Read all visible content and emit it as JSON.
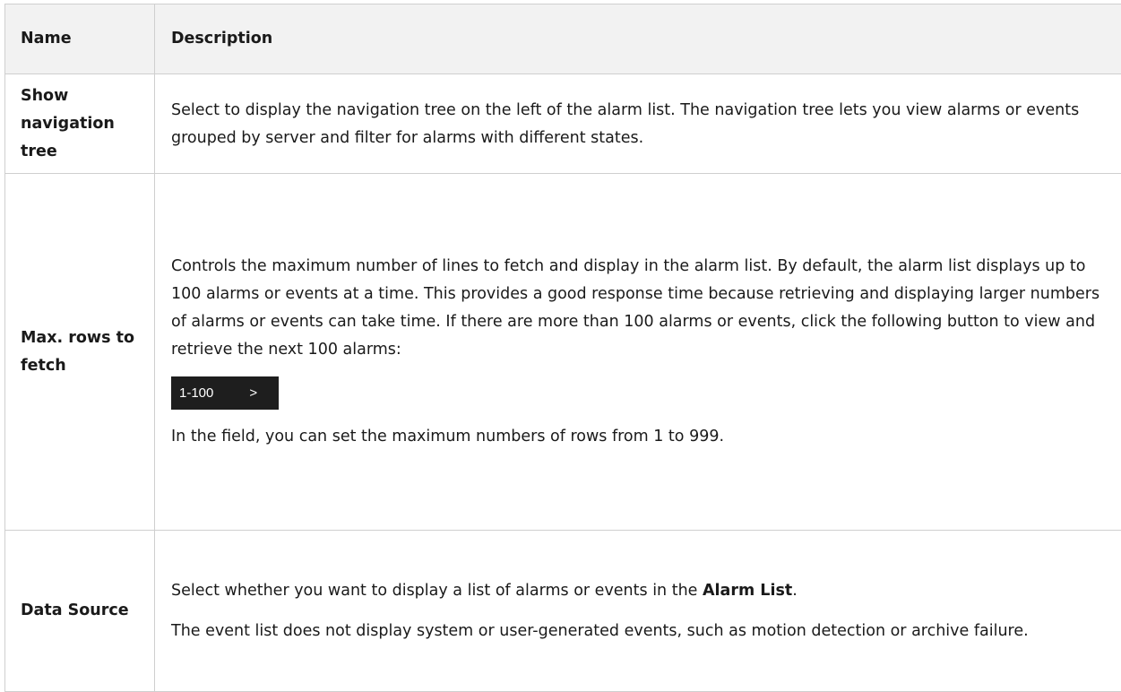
{
  "table": {
    "headers": {
      "name": "Name",
      "description": "Description"
    },
    "rows": [
      {
        "name": "Show navigation tree",
        "paragraphs": [
          "Select to display the navigation tree on the left of the alarm list. The navigation tree lets you view alarms or events grouped by server and filter for alarms with different states."
        ]
      },
      {
        "name": "Max. rows to fetch",
        "paragraphs": [
          "Controls the maximum number of lines to fetch and display in the alarm list. By default, the alarm list displays up to 100 alarms or events at a time. This provides a good response time because retrieving and displaying larger numbers of alarms or events can take time. If there are more than 100 alarms or events, click the following button to view and retrieve the next 100 alarms:",
          "In the field, you can set the maximum numbers of rows from 1 to 999."
        ],
        "button_image": {
          "range": "1-100",
          "chevron": ">"
        }
      },
      {
        "name": "Data Source",
        "paragraphs": [
          "The event list does not display system or user-generated events, such as motion detection or archive failure."
        ],
        "first_paragraph": {
          "before": "Select whether you want to display a list of alarms or events in the ",
          "bold": "Alarm List",
          "after": "."
        }
      }
    ]
  }
}
